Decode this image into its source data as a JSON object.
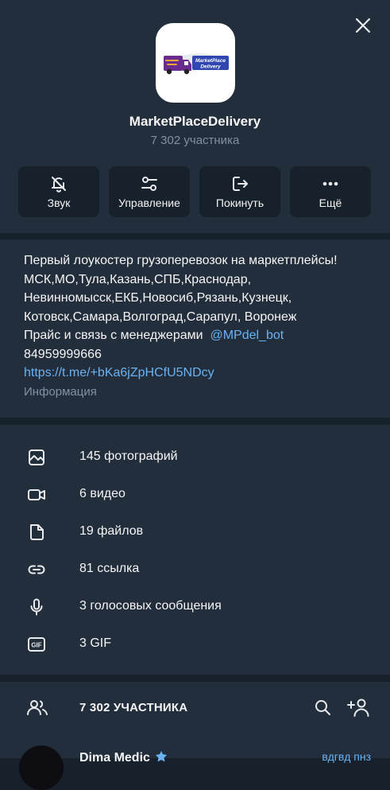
{
  "group": {
    "logo_text": "MarketPlace Delivery",
    "name": "MarketPlaceDelivery",
    "members_count": "7 302 участника"
  },
  "actions": [
    {
      "label": "Звук",
      "icon": "bell-off-icon"
    },
    {
      "label": "Управление",
      "icon": "sliders-icon"
    },
    {
      "label": "Покинуть",
      "icon": "leave-icon"
    },
    {
      "label": "Ещё",
      "icon": "more-icon"
    }
  ],
  "about": {
    "line1": "Первый лоукостер грузоперевозок на маркетплейсы!",
    "line2": "МСК,МО,Тула,Казань,СПБ,Краснодар,",
    "line3": "Невинномысск,ЕКБ,Новосиб,Рязань,Кузнецк,",
    "line4": "Котовск,Самара,Волгоград,Сарапул, Воронеж",
    "line5_text": "Прайс и связь с менеджерами",
    "line5_link": "@MPdel_bot",
    "phone": "84959999666",
    "invite_link": "https://t.me/+bKa6jZpHCfU5NDcy",
    "hint": "Информация"
  },
  "media": [
    {
      "label": "145 фотографий",
      "icon": "photo-icon"
    },
    {
      "label": "6 видео",
      "icon": "video-icon"
    },
    {
      "label": "19 файлов",
      "icon": "file-icon"
    },
    {
      "label": "81 ссылка",
      "icon": "link-icon"
    },
    {
      "label": "3 голосовых сообщения",
      "icon": "microphone-icon"
    },
    {
      "label": "3 GIF",
      "icon": "gif-icon"
    }
  ],
  "members": {
    "title": "7 302 УЧАСТНИКА",
    "first_member": {
      "name": "Dima Medic",
      "status": "вдгвд пнз"
    }
  },
  "colors": {
    "background": "#17212b",
    "panel": "#232e3c",
    "text": "#f5f5f5",
    "secondary_text": "#7f91a4",
    "link": "#6ab2f2",
    "icon": "#e8eaed"
  }
}
